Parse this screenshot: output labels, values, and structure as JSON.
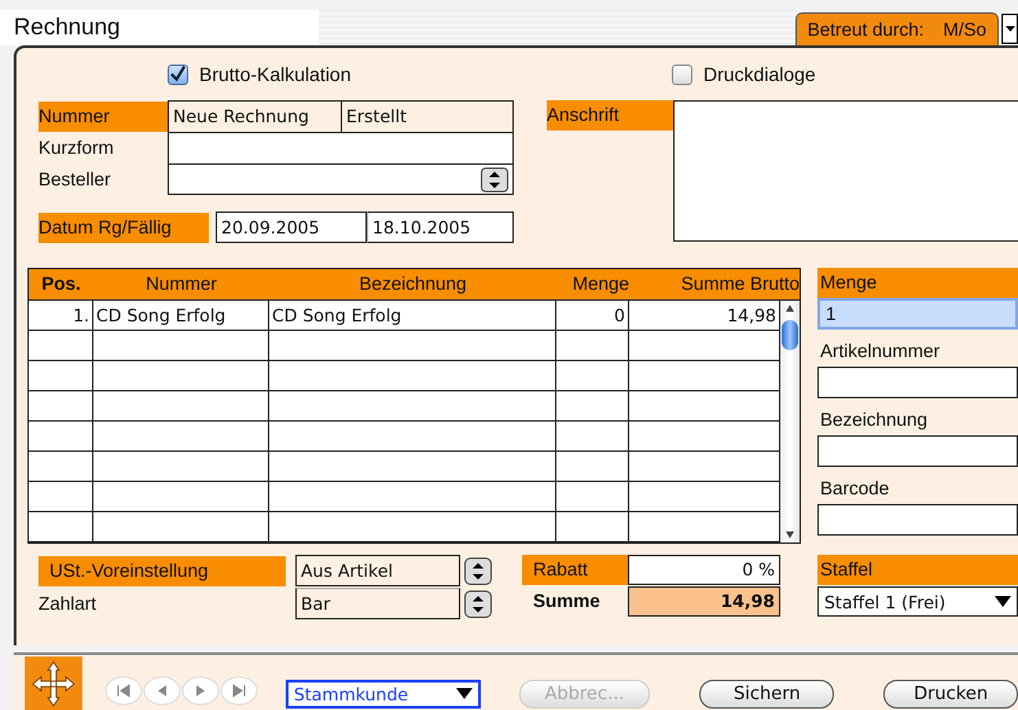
{
  "window": {
    "title": "Rechnung"
  },
  "assigned": {
    "label": "Betreut durch:",
    "value": "M/So"
  },
  "options": [
    {
      "label": "Brutto-Kalkulation",
      "checked": true
    },
    {
      "label": "Druckdialoge",
      "checked": false
    }
  ],
  "nummer": {
    "label": "Nummer",
    "value": "Neue Rechnung",
    "status": "Erstellt"
  },
  "kurzform": {
    "label": "Kurzform"
  },
  "besteller": {
    "label": "Besteller"
  },
  "dates": {
    "label": "Datum Rg/Fällig",
    "invoice": "20.09.2005",
    "due": "18.10.2005"
  },
  "address": {
    "label": "Anschrift"
  },
  "table": {
    "columns": [
      "Pos.",
      "Nummer",
      "Bezeichnung",
      "Menge",
      "Summe Brutto"
    ],
    "rows": [
      [
        "1.",
        "CD Song Erfolg",
        "CD Song Erfolg",
        "0",
        "14,98"
      ]
    ]
  },
  "item_fields": [
    {
      "label": "Menge",
      "kind": "header",
      "value": "1",
      "focused": true
    },
    {
      "label": "Artikelnummer",
      "kind": "plain",
      "focused": false
    },
    {
      "label": "Bezeichnung",
      "kind": "plain",
      "focused": false
    },
    {
      "label": "Barcode",
      "kind": "plain",
      "focused": false
    }
  ],
  "ust": {
    "label": "USt.-Voreinstellung",
    "value": "Aus Artikel"
  },
  "zahlart": {
    "label": "Zahlart",
    "value": "Bar"
  },
  "rabatt": {
    "label": "Rabatt",
    "value": "0 %"
  },
  "summe": {
    "label": "Summe",
    "value": "14,98"
  },
  "staffel": {
    "label": "Staffel",
    "value": "Staffel 1 (Frei)"
  },
  "customer_type": "Stammkunde",
  "buttons": [
    {
      "label": "Abbrec...",
      "disabled": true
    },
    {
      "label": "Sichern",
      "disabled": false
    },
    {
      "label": "Drucken",
      "disabled": false
    }
  ]
}
